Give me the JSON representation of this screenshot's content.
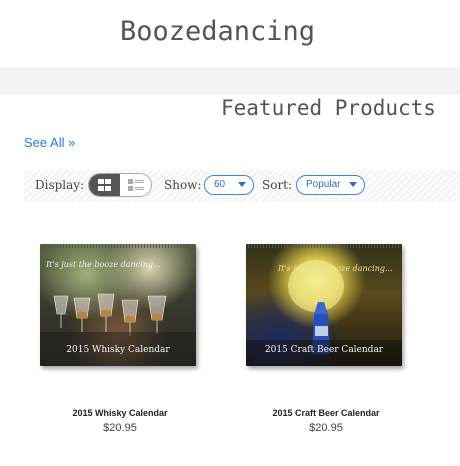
{
  "header": {
    "site_title": "Boozedancing"
  },
  "featured": {
    "title": "Featured Products",
    "see_all": "See All »"
  },
  "toolbar": {
    "display_label": "Display:",
    "show_label": "Show:",
    "show_value": "60",
    "sort_label": "Sort:",
    "sort_value": "Popular",
    "active_view": "grid"
  },
  "products": [
    {
      "name": "2015 Whisky Calendar",
      "price": "$20.95",
      "image_tagline": "It's just the booze dancing...",
      "image_caption": "2015 Whisky Calendar"
    },
    {
      "name": "2015 Craft Beer Calendar",
      "price": "$20.95",
      "image_tagline": "It's just the booze dancing...",
      "image_caption": "2015 Craft Beer Calendar"
    }
  ],
  "colors": {
    "link": "#2a7ad6",
    "accent": "#3d86d8",
    "title": "#555555"
  },
  "icons": {
    "grid_view": "grid-view-icon",
    "list_view": "list-view-icon",
    "dropdown": "chevron-down-icon"
  }
}
